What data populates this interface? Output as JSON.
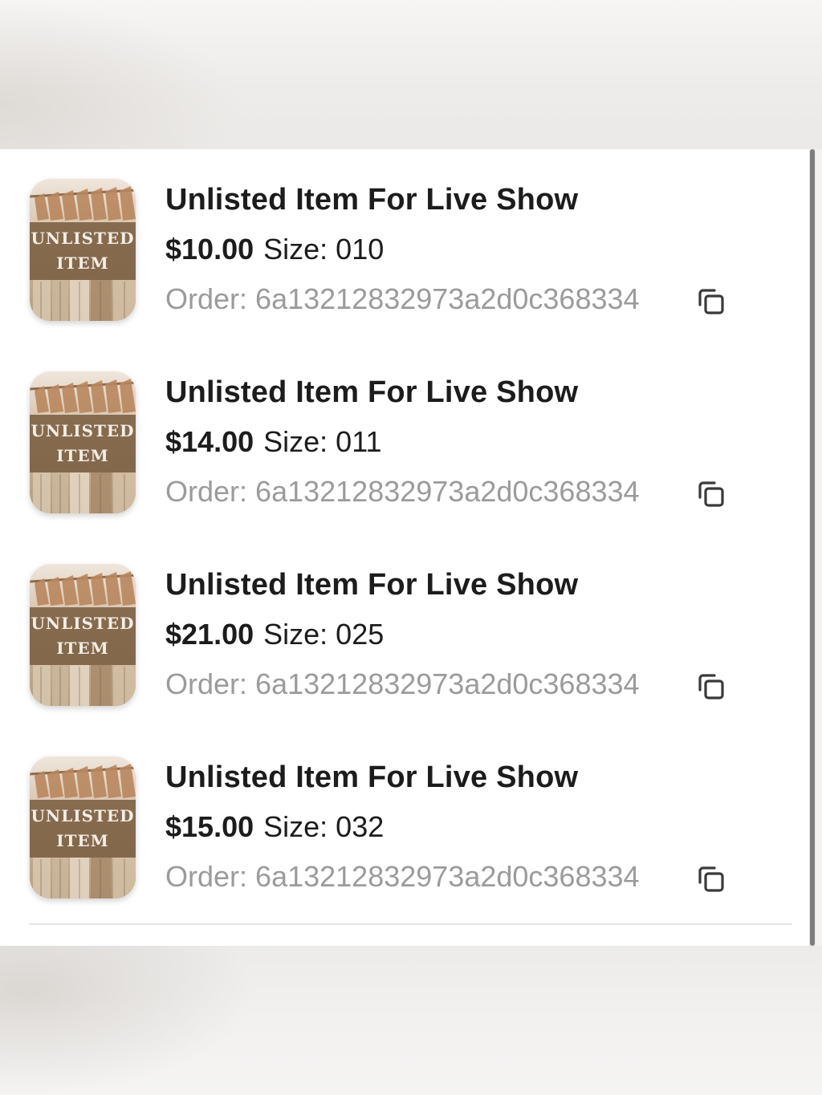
{
  "orders": [
    {
      "title": "Unlisted Item For Live Show",
      "price": "$10.00",
      "size_label": "Size:",
      "size_value": "010",
      "order_label": "Order:",
      "order_id": "6a13212832973a2d0c368334",
      "thumbnail_text": [
        "UNLISTED",
        "ITEM"
      ]
    },
    {
      "title": "Unlisted Item For Live Show",
      "price": "$14.00",
      "size_label": "Size:",
      "size_value": "011",
      "order_label": "Order:",
      "order_id": "6a13212832973a2d0c368334",
      "thumbnail_text": [
        "UNLISTED",
        "ITEM"
      ]
    },
    {
      "title": "Unlisted Item For Live Show",
      "price": "$21.00",
      "size_label": "Size:",
      "size_value": "025",
      "order_label": "Order:",
      "order_id": "6a13212832973a2d0c368334",
      "thumbnail_text": [
        "UNLISTED",
        "ITEM"
      ]
    },
    {
      "title": "Unlisted Item For Live Show",
      "price": "$15.00",
      "size_label": "Size:",
      "size_value": "032",
      "order_label": "Order:",
      "order_id": "6a13212832973a2d0c368334",
      "thumbnail_text": [
        "UNLISTED",
        "ITEM"
      ]
    }
  ],
  "icons": {
    "copy": "copy-icon"
  },
  "colors": {
    "title_text": "#1c1c1c",
    "secondary_text": "#9b9b9b",
    "thumbnail_label_bg": "#7a5e42"
  }
}
